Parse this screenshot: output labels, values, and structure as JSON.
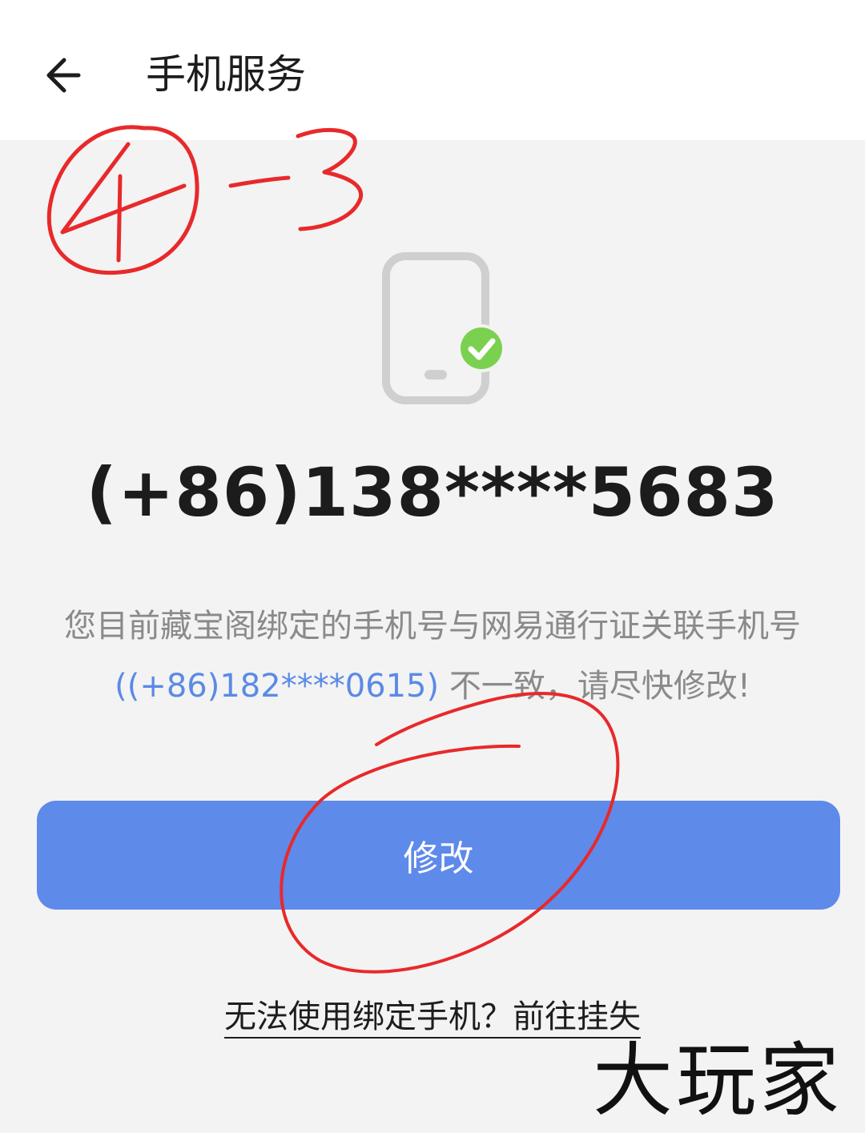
{
  "header": {
    "title": "手机服务",
    "back_icon": "arrow-left-icon"
  },
  "annotation": {
    "step_label": "④-3",
    "color": "#e8292b"
  },
  "status": {
    "icon": "phone-verified-icon",
    "phone_number": "(+86)138****5683"
  },
  "notice": {
    "text_before": "您目前藏宝阁绑定的手机号与网易通行证关联手机号",
    "linked_phone": "((+86)182****0615)",
    "text_after": "不一致，请尽快修改!"
  },
  "actions": {
    "modify_label": "修改",
    "report_loss_label": "无法使用绑定手机？前往挂失"
  },
  "watermark": "大玩家",
  "colors": {
    "accent": "#5e8aea",
    "link": "#5b8ae6",
    "check_green": "#7bd14f",
    "annotation_red": "#e8292b"
  }
}
